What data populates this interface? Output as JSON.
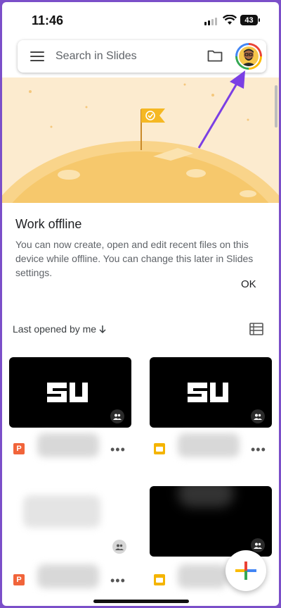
{
  "status_bar": {
    "time": "11:46",
    "battery": "43"
  },
  "search": {
    "placeholder": "Search in Slides"
  },
  "icons": {
    "menu": "menu-icon",
    "folder": "folder-icon",
    "avatar": "account-avatar",
    "list_view": "list-view-icon",
    "shared": "shared-people-icon",
    "more": "more-horiz-icon",
    "add": "plus-icon"
  },
  "banner": {
    "title": "Work offline",
    "body": "You can now create, open and edit recent files on this device while offline. You can change this later in Slides settings.",
    "ok_label": "OK"
  },
  "sort": {
    "label": "Last opened by me"
  },
  "files": [
    {
      "type": "P",
      "thumbnail_text": "SU",
      "shared": true
    },
    {
      "type": "slides",
      "thumbnail_text": "SU",
      "shared": true
    },
    {
      "type": "P",
      "thumbnail_text": "",
      "shared": true
    },
    {
      "type": "slides",
      "thumbnail_text": "",
      "shared": true
    }
  ],
  "colors": {
    "annotation_arrow": "#7b3fe4",
    "banner_background": "#fcebcf",
    "ppt_icon": "#f1643a",
    "slides_icon": "#f4b400"
  }
}
